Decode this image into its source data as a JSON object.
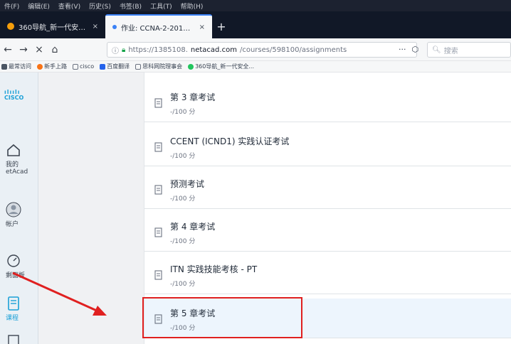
{
  "browser": {
    "menu_items": [
      "件(F)",
      "编辑(E)",
      "查看(V)",
      "历史(S)",
      "书签(B)",
      "工具(T)",
      "帮助(H)"
    ],
    "tabs": [
      {
        "title": "360导航_新一代安全上网导航",
        "close": "×"
      },
      {
        "title": "作业: CCNA-2-2017学研班",
        "close": "×"
      }
    ],
    "new_tab": "+",
    "nav": {
      "back": "←",
      "forward": "→",
      "stop": "×",
      "home": "⌂"
    },
    "url": {
      "prefix": "https://1385108.",
      "domain": "netacad.com",
      "path": "/courses/598100/assignments"
    },
    "url_more": "···",
    "search_placeholder": "搜索",
    "bookmarks": [
      "最常访问",
      "新手上路",
      "cisco",
      "百度翻译",
      "思科网院理事会",
      "360导航_新一代安全..."
    ]
  },
  "sidebar": {
    "logo_bars": "ılıılı",
    "logo_text": "CISCO",
    "items": [
      {
        "label_line1": "我的",
        "label_line2": "etAcad",
        "icon": "home-icon"
      },
      {
        "label": "帐户",
        "icon": "user-icon"
      },
      {
        "label": "剩面板",
        "icon": "dashboard-icon"
      },
      {
        "label": "课程",
        "icon": "course-icon"
      }
    ]
  },
  "assignments": [
    {
      "title": "第 3 章考试",
      "score": "-/100 分"
    },
    {
      "title": "CCENT (ICND1) 实践认证考试",
      "score": "-/100 分"
    },
    {
      "title": "预测考试",
      "score": "-/100 分"
    },
    {
      "title": "第 4 章考试",
      "score": "-/100 分"
    },
    {
      "title": "ITN 实践技能考核 - PT",
      "score": "-/100 分"
    },
    {
      "title": "第 5 章考试",
      "score": "-/100 分"
    }
  ],
  "colors": {
    "accent": "#1ba0d7",
    "annotation": "#e02020"
  }
}
